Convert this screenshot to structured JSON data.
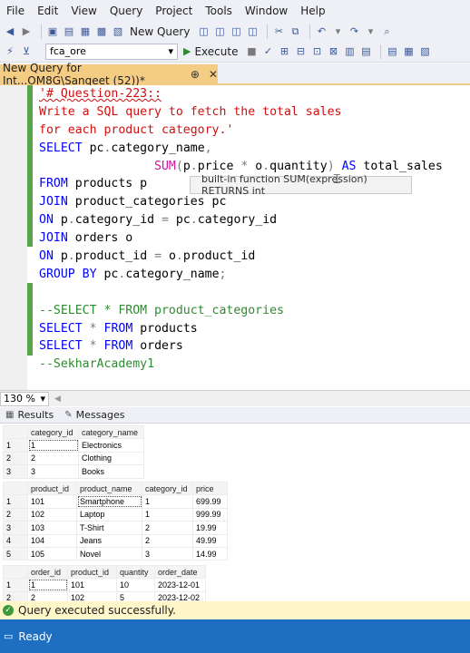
{
  "menu": [
    "File",
    "Edit",
    "View",
    "Query",
    "Project",
    "Tools",
    "Window",
    "Help"
  ],
  "toolbar": {
    "new_query_label": "New Query",
    "database_value": "fca_ore",
    "execute_label": "Execute"
  },
  "query_tab": {
    "title": "New Query for Int...OM8G\\Sangeet (52))*",
    "pin": "⊕",
    "close": "✕"
  },
  "code_lines": [
    [
      "'# Question-223::"
    ],
    [
      "Write a SQL query to fetch the total sales"
    ],
    [
      "for each product category.'"
    ],
    [
      "SELECT",
      " pc",
      ".",
      "category_name",
      ","
    ],
    [
      "                ",
      "SUM",
      "(",
      "p",
      ".",
      "price ",
      "*",
      " o",
      ".",
      "quantity",
      ")",
      " AS ",
      "total_sales"
    ],
    [
      "FROM",
      " products p"
    ],
    [
      "JOIN",
      " product_categories pc"
    ],
    [
      "ON",
      " p",
      ".",
      "category_id ",
      "=",
      " pc",
      ".",
      "category_id"
    ],
    [
      "JOIN",
      " orders o"
    ],
    [
      "ON",
      " p",
      ".",
      "product_id ",
      "=",
      " o",
      ".",
      "product_id"
    ],
    [
      "GROUP BY",
      " pc",
      ".",
      "category_name",
      ";"
    ],
    [
      ""
    ],
    [
      "--SELECT * FROM product_categories"
    ],
    [
      "SELECT",
      " ",
      "*",
      " ",
      "FROM",
      " products"
    ],
    [
      "SELECT",
      " ",
      "*",
      " ",
      "FROM",
      " orders"
    ],
    [
      "--SekharAcademy1"
    ]
  ],
  "tooltip": "built-in function SUM(expression) RETURNS int",
  "zoom": "130 %",
  "result_tabs": {
    "results": "Results",
    "messages": "Messages"
  },
  "grid1": {
    "headers": [
      "category_id",
      "category_name"
    ],
    "rows": [
      [
        "1",
        "1",
        "Electronics"
      ],
      [
        "2",
        "2",
        "Clothing"
      ],
      [
        "3",
        "3",
        "Books"
      ]
    ]
  },
  "grid2": {
    "headers": [
      "product_id",
      "product_name",
      "category_id",
      "price"
    ],
    "rows": [
      [
        "1",
        "101",
        "Smartphone",
        "1",
        "699.99"
      ],
      [
        "2",
        "102",
        "Laptop",
        "1",
        "999.99"
      ],
      [
        "3",
        "103",
        "T-Shirt",
        "2",
        "19.99"
      ],
      [
        "4",
        "104",
        "Jeans",
        "2",
        "49.99"
      ],
      [
        "5",
        "105",
        "Novel",
        "3",
        "14.99"
      ]
    ]
  },
  "grid3": {
    "headers": [
      "order_id",
      "product_id",
      "quantity",
      "order_date"
    ],
    "rows": [
      [
        "1",
        "1",
        "101",
        "10",
        "2023-12-01"
      ],
      [
        "2",
        "2",
        "102",
        "5",
        "2023-12-02"
      ]
    ]
  },
  "status_message": "Query executed successfully.",
  "ready_label": "Ready",
  "colors": {
    "keyword": "#0000ff",
    "string": "#d01010",
    "function": "#d0159a",
    "comment": "#2f8b2f",
    "operator": "#7a7a7a",
    "tab_active": "#f5cc84",
    "status_bar": "#1e6fc2"
  }
}
